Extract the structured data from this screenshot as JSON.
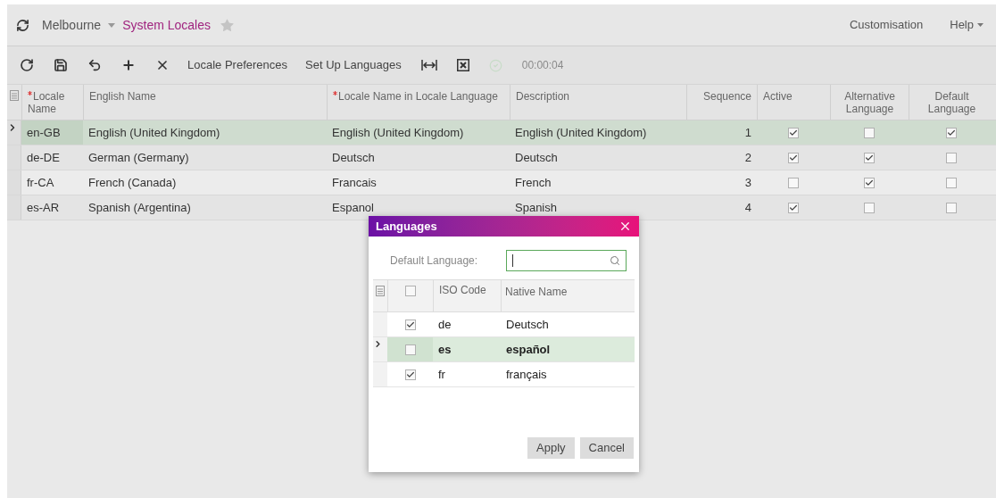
{
  "header": {
    "company": "Melbourne",
    "title": "System Locales",
    "links": [
      {
        "label": "Customisation",
        "dropdown": false
      },
      {
        "label": "Help",
        "dropdown": true
      }
    ]
  },
  "toolbar": {
    "icons": [
      {
        "kind": "refresh"
      },
      {
        "kind": "save"
      },
      {
        "kind": "undo"
      },
      {
        "kind": "add"
      },
      {
        "kind": "delete"
      }
    ],
    "actions": [
      "Locale Preferences",
      "Set Up Languages"
    ],
    "timer": "00:00:04"
  },
  "table": {
    "columns": [
      {
        "label": "Locale Name",
        "required": true
      },
      {
        "label": "English Name",
        "required": false
      },
      {
        "label": "Locale Name in Locale Language",
        "required": true
      },
      {
        "label": "Description",
        "required": false
      },
      {
        "label": "Sequence",
        "required": false
      },
      {
        "label": "Active",
        "required": false
      },
      {
        "label": "Alternative Language",
        "required": false
      },
      {
        "label": "Default Language",
        "required": false
      }
    ],
    "rows": [
      {
        "selected": true,
        "locale": "en-GB",
        "english": "English (United Kingdom)",
        "native": "English (United Kingdom)",
        "description": "English (United Kingdom)",
        "sequence": "1",
        "active": true,
        "alternative": false,
        "default": true
      },
      {
        "selected": false,
        "locale": "de-DE",
        "english": "German (Germany)",
        "native": "Deutsch",
        "description": "Deutsch",
        "sequence": "2",
        "active": true,
        "alternative": true,
        "default": false
      },
      {
        "selected": false,
        "locale": "fr-CA",
        "english": "French (Canada)",
        "native": "Francais",
        "description": "French",
        "sequence": "3",
        "active": false,
        "alternative": true,
        "default": false
      },
      {
        "selected": false,
        "locale": "es-AR",
        "english": "Spanish (Argentina)",
        "native": "Espanol",
        "description": "Spanish",
        "sequence": "4",
        "active": true,
        "alternative": false,
        "default": false
      }
    ]
  },
  "dialog": {
    "title": "Languages",
    "field_label": "Default Language:",
    "select_all_checked": false,
    "columns": [
      "ISO Code",
      "Native Name"
    ],
    "rows": [
      {
        "selected": false,
        "checked": true,
        "code": "de",
        "name": "Deutsch"
      },
      {
        "selected": true,
        "checked": false,
        "code": "es",
        "name": "español"
      },
      {
        "selected": false,
        "checked": true,
        "code": "fr",
        "name": "français"
      }
    ],
    "buttons": [
      "Apply",
      "Cancel"
    ]
  }
}
